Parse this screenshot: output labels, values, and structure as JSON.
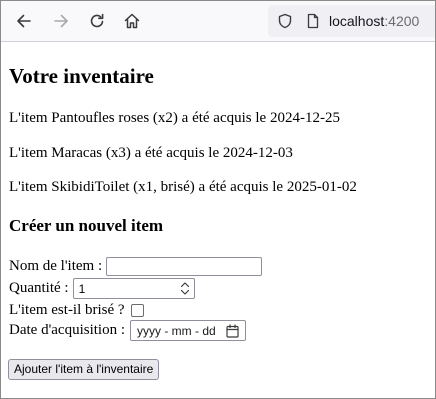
{
  "browser": {
    "url_host": "localhost",
    "url_port": ":4200",
    "icons": {
      "back": "arrow-left-icon",
      "forward": "arrow-right-icon",
      "reload": "reload-icon",
      "home": "home-icon",
      "shield": "shield-icon",
      "page": "page-icon"
    }
  },
  "page": {
    "title": "Votre inventaire",
    "items": [
      "L'item Pantoufles roses (x2) a été acquis le 2024-12-25",
      "L'item Maracas (x3) a été acquis le 2024-12-03",
      "L'item SkibidiToilet (x1, brisé) a été acquis le 2025-01-02"
    ],
    "form": {
      "title": "Créer un nouvel item",
      "name_label": "Nom de l'item :",
      "name_value": "",
      "quantity_label": "Quantité :",
      "quantity_value": "1",
      "broken_label": "L'item est-il brisé ?",
      "broken_checked": false,
      "date_label": "Date d'acquisition :",
      "date_placeholder": "yyyy - mm - dd",
      "submit_label": "Ajouter l'item à l'inventaire"
    }
  }
}
